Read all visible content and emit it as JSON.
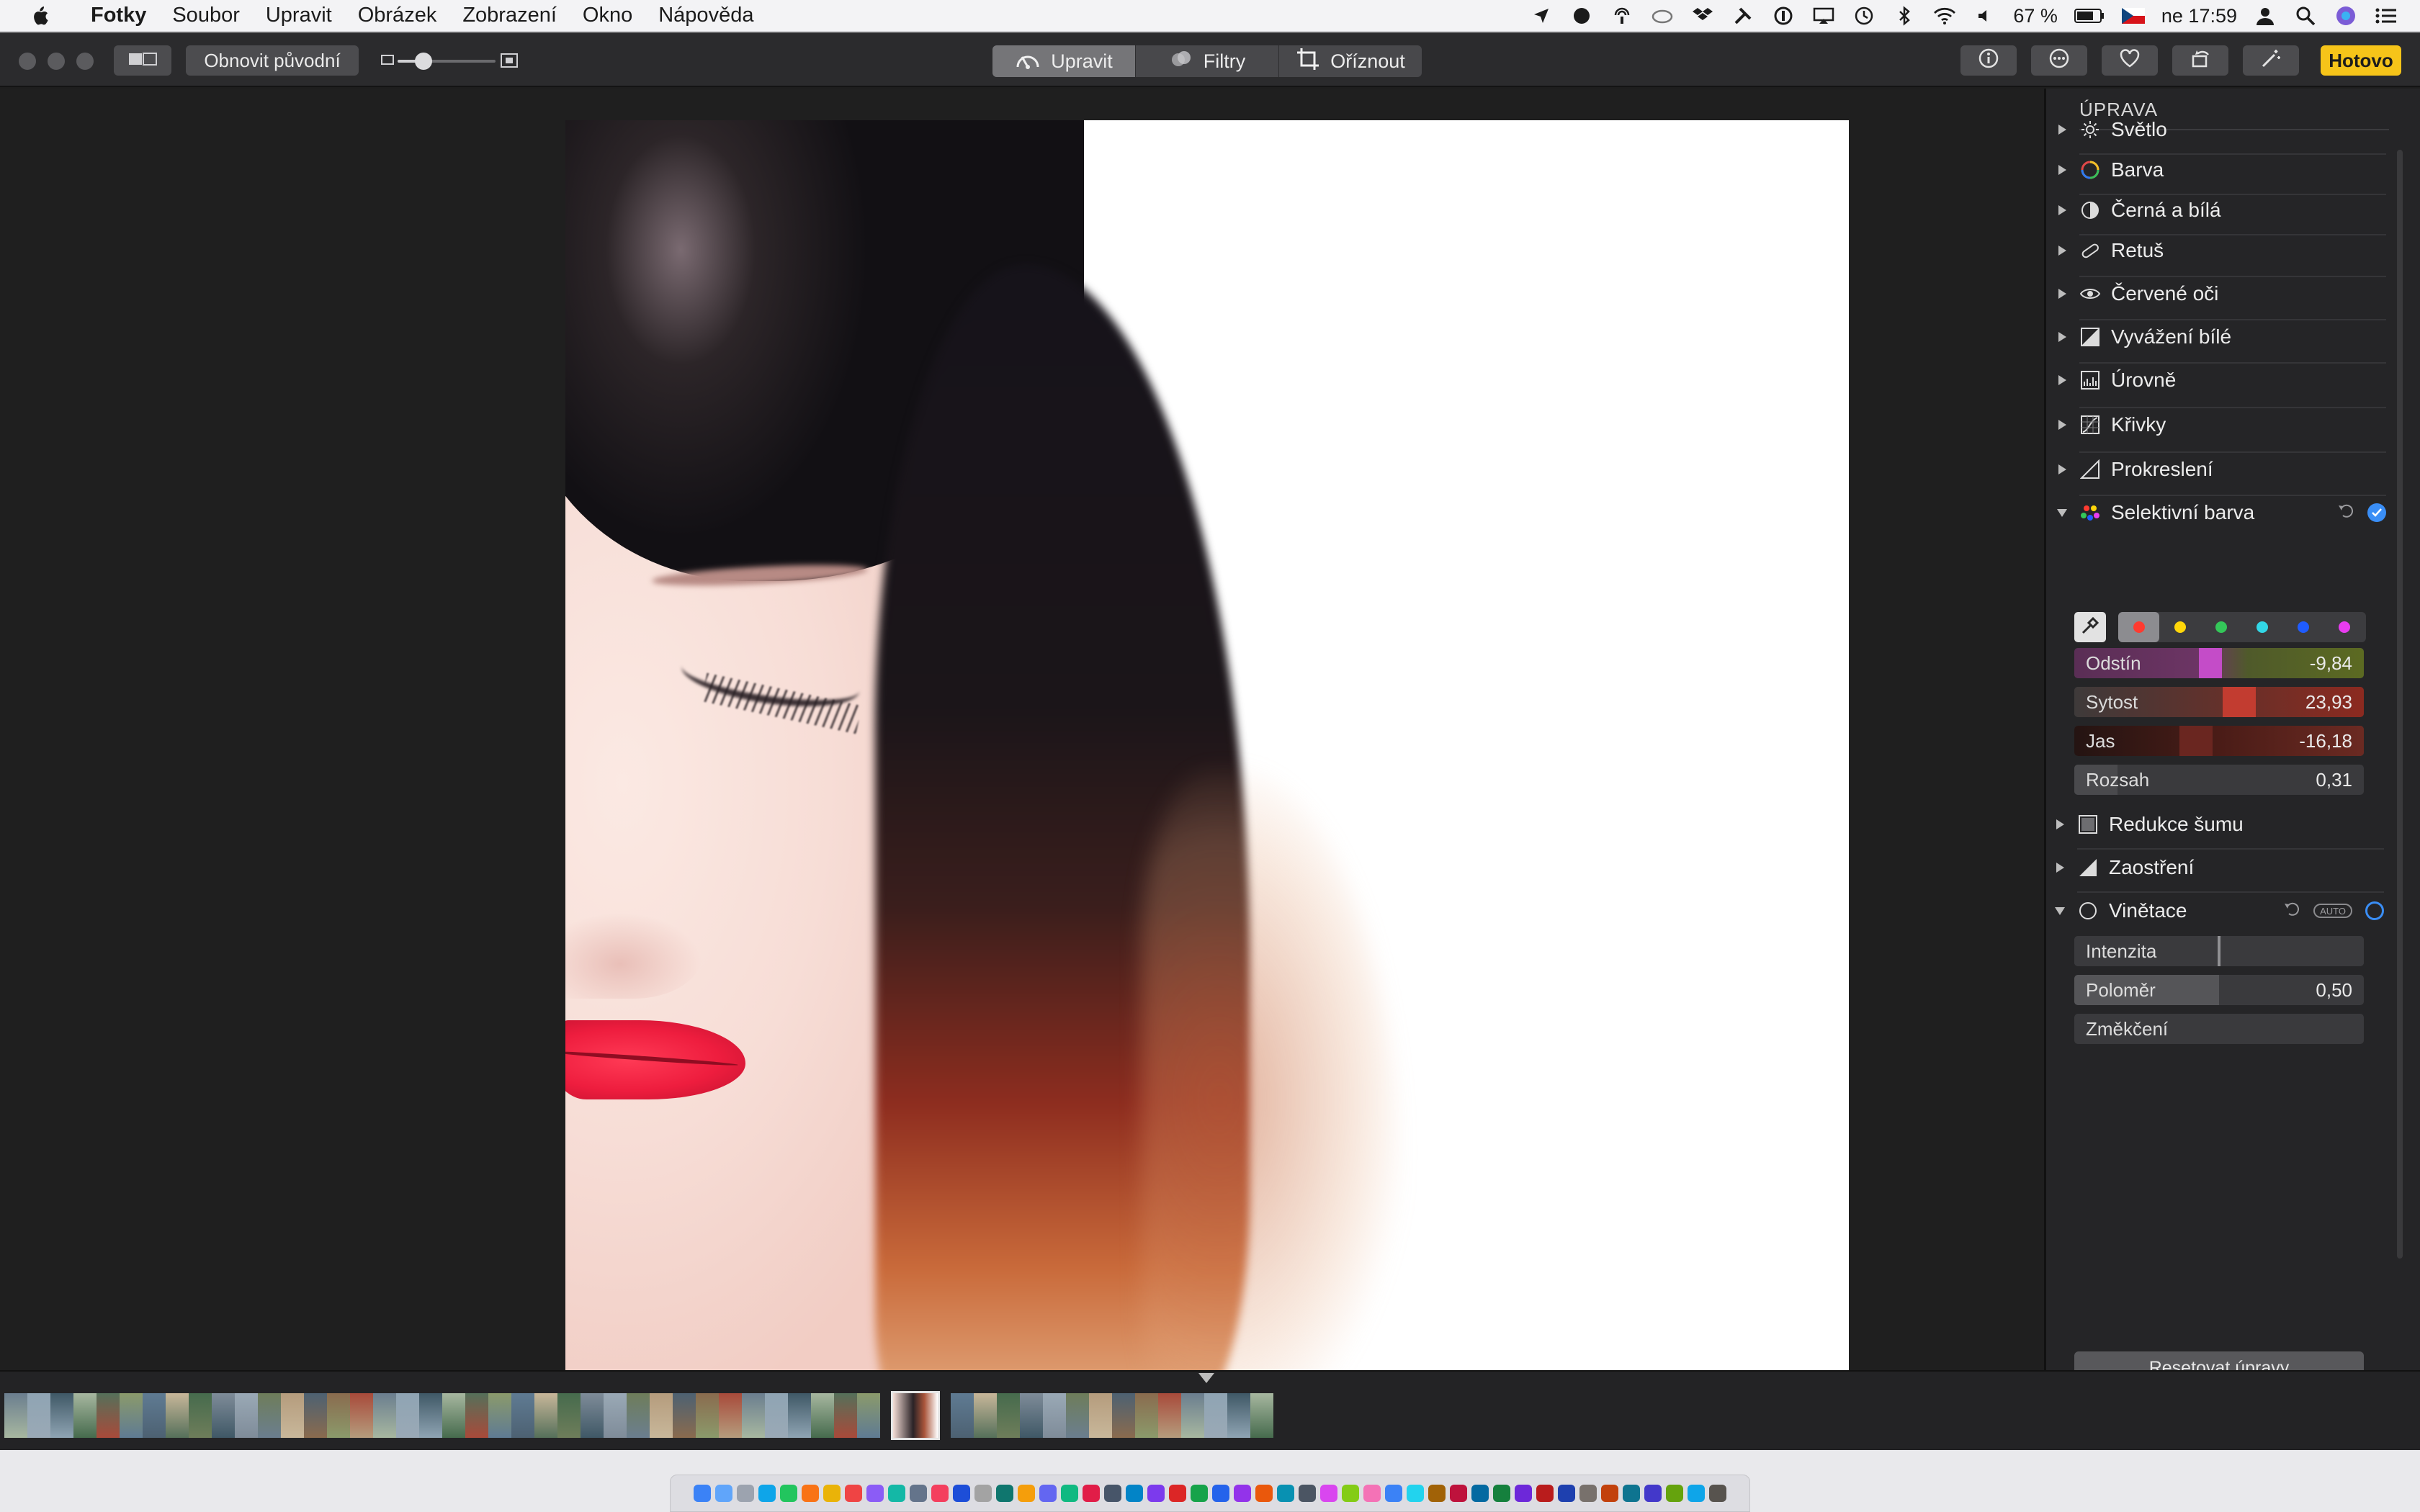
{
  "menubar": {
    "items": [
      "Fotky",
      "Soubor",
      "Upravit",
      "Obrázek",
      "Zobrazení",
      "Okno",
      "Nápověda"
    ],
    "battery": "67 %",
    "clock": "ne 17:59"
  },
  "toolbar": {
    "revert_label": "Obnovit původní",
    "tabs": [
      {
        "label": "Upravit",
        "active": true
      },
      {
        "label": "Filtry",
        "active": false
      },
      {
        "label": "Oříznout",
        "active": false
      }
    ],
    "done_label": "Hotovo",
    "zoom_level": 0.12
  },
  "panel": {
    "title": "ÚPRAVA",
    "adjustments": [
      {
        "label": "Světlo",
        "icon": "sun-icon",
        "expanded": false
      },
      {
        "label": "Barva",
        "icon": "color-circle-icon",
        "expanded": false
      },
      {
        "label": "Černá a bílá",
        "icon": "half-circle-icon",
        "expanded": false
      },
      {
        "label": "Retuš",
        "icon": "bandage-icon",
        "expanded": false
      },
      {
        "label": "Červené oči",
        "icon": "eye-icon",
        "expanded": false
      },
      {
        "label": "Vyvážení bílé",
        "icon": "white-balance-icon",
        "expanded": false
      },
      {
        "label": "Úrovně",
        "icon": "levels-icon",
        "expanded": false
      },
      {
        "label": "Křivky",
        "icon": "curves-icon",
        "expanded": false
      },
      {
        "label": "Prokreslení",
        "icon": "definition-icon",
        "expanded": false
      },
      {
        "label": "Selektivní barva",
        "icon": "selective-color-icon",
        "expanded": true
      },
      {
        "label": "Redukce šumu",
        "icon": "noise-icon",
        "expanded": false
      },
      {
        "label": "Zaostření",
        "icon": "sharpen-icon",
        "expanded": false
      },
      {
        "label": "Vinětace",
        "icon": "vignette-icon",
        "expanded": true
      }
    ],
    "selective_color": {
      "swatches": [
        "#ff3b30",
        "#ffd60a",
        "#34c759",
        "#32d7e6",
        "#1f5cff",
        "#e83cf0"
      ],
      "selected_swatch": 0,
      "sliders": [
        {
          "label": "Odstín",
          "value": "-9,84",
          "level": 0.47
        },
        {
          "label": "Sytost",
          "value": "23,93",
          "level": 0.57
        },
        {
          "label": "Jas",
          "value": "-16,18",
          "level": 0.42
        },
        {
          "label": "Rozsah",
          "value": "0,31",
          "level": 0.15
        }
      ]
    },
    "vignette": {
      "auto_label": "AUTO",
      "sliders": [
        {
          "label": "Intenzita",
          "value": "",
          "level": 0.5
        },
        {
          "label": "Poloměr",
          "value": "0,50",
          "level": 0.5
        },
        {
          "label": "Změkčení",
          "value": "",
          "level": 0.0
        }
      ]
    },
    "reset_label": "Resetovat úpravy"
  },
  "colors": {
    "accent": "#3a8ef6",
    "done": "#f6c419",
    "lips": "#ee1d3e"
  }
}
